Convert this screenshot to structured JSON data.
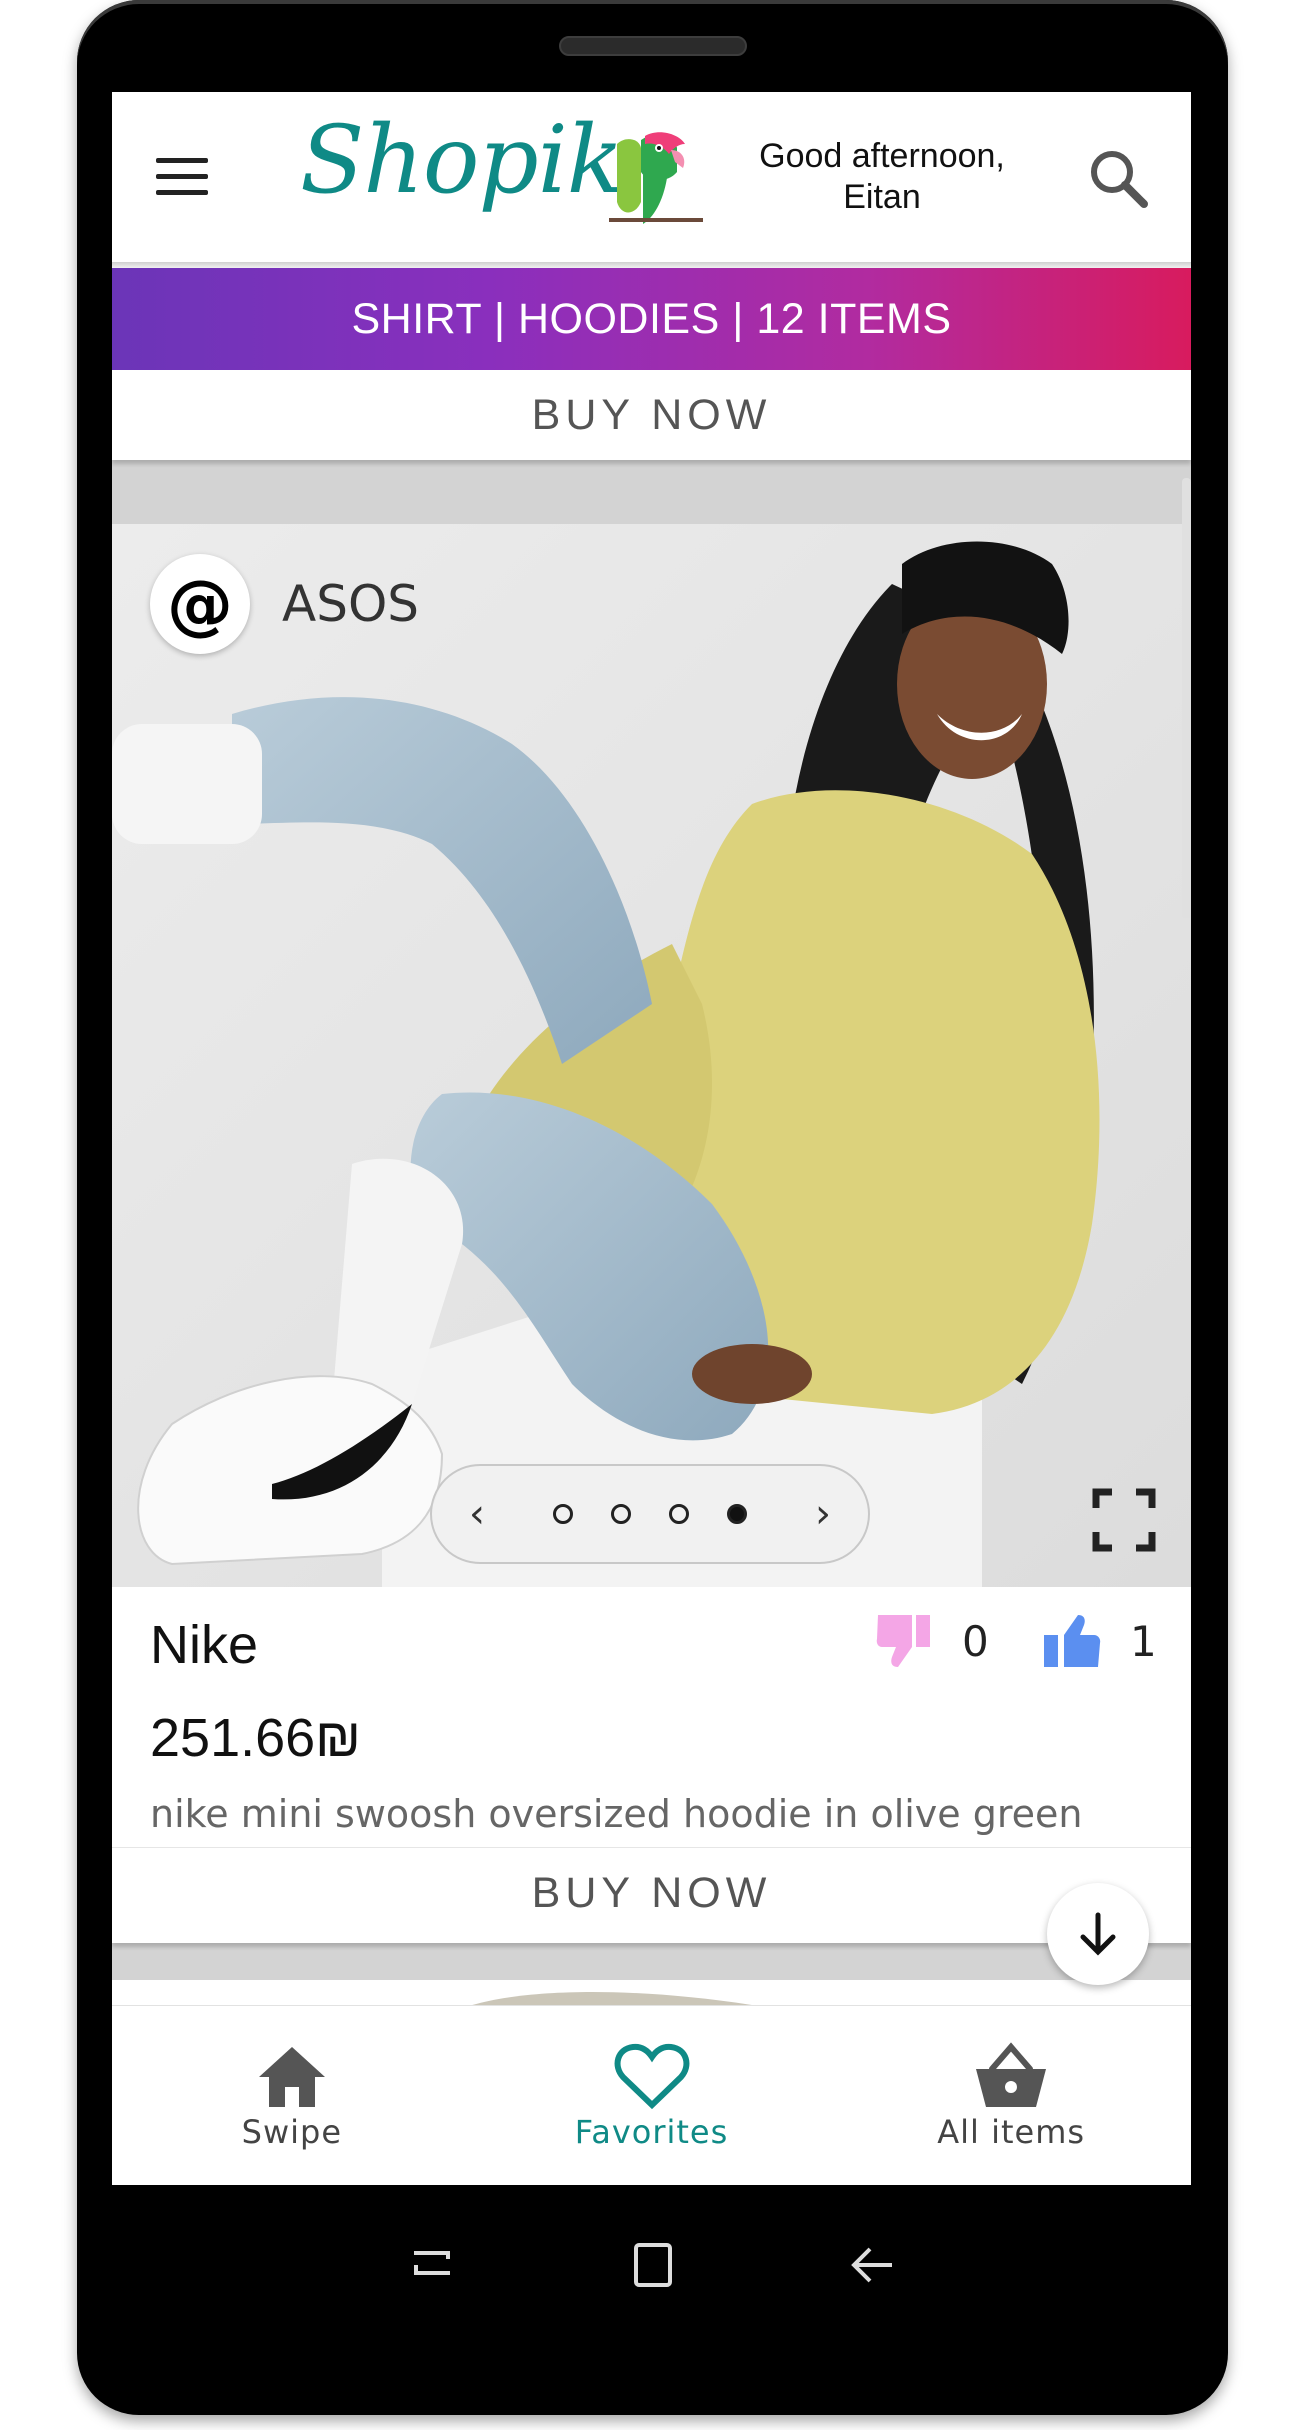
{
  "header": {
    "logo_text": "Shopik",
    "greeting_line1": "Good afternoon,",
    "greeting_line2": "Eitan"
  },
  "banner": {
    "text": "SHIRT | HOODIES | 12 ITEMS",
    "buy_label": "BUY NOW"
  },
  "product": {
    "store_logo": "@",
    "store_name": "ASOS",
    "brand": "Nike",
    "price": "251.66₪",
    "description": "nike mini swoosh oversized hoodie in olive green",
    "dislikes": "0",
    "likes": "1",
    "buy_label": "BUY NOW",
    "carousel": {
      "total": 4,
      "active_index": 3
    }
  },
  "bottom_nav": {
    "items": [
      {
        "label": "Swipe",
        "icon": "home-icon"
      },
      {
        "label": "Favorites",
        "icon": "heart-icon"
      },
      {
        "label": "All items",
        "icon": "basket-icon"
      }
    ],
    "active": "Favorites"
  },
  "colors": {
    "accent": "#0f8a86",
    "banner_start": "#6b35b8",
    "banner_end": "#d81b5e",
    "dislike": "#f4a6e6",
    "like": "#5b8ff0"
  }
}
